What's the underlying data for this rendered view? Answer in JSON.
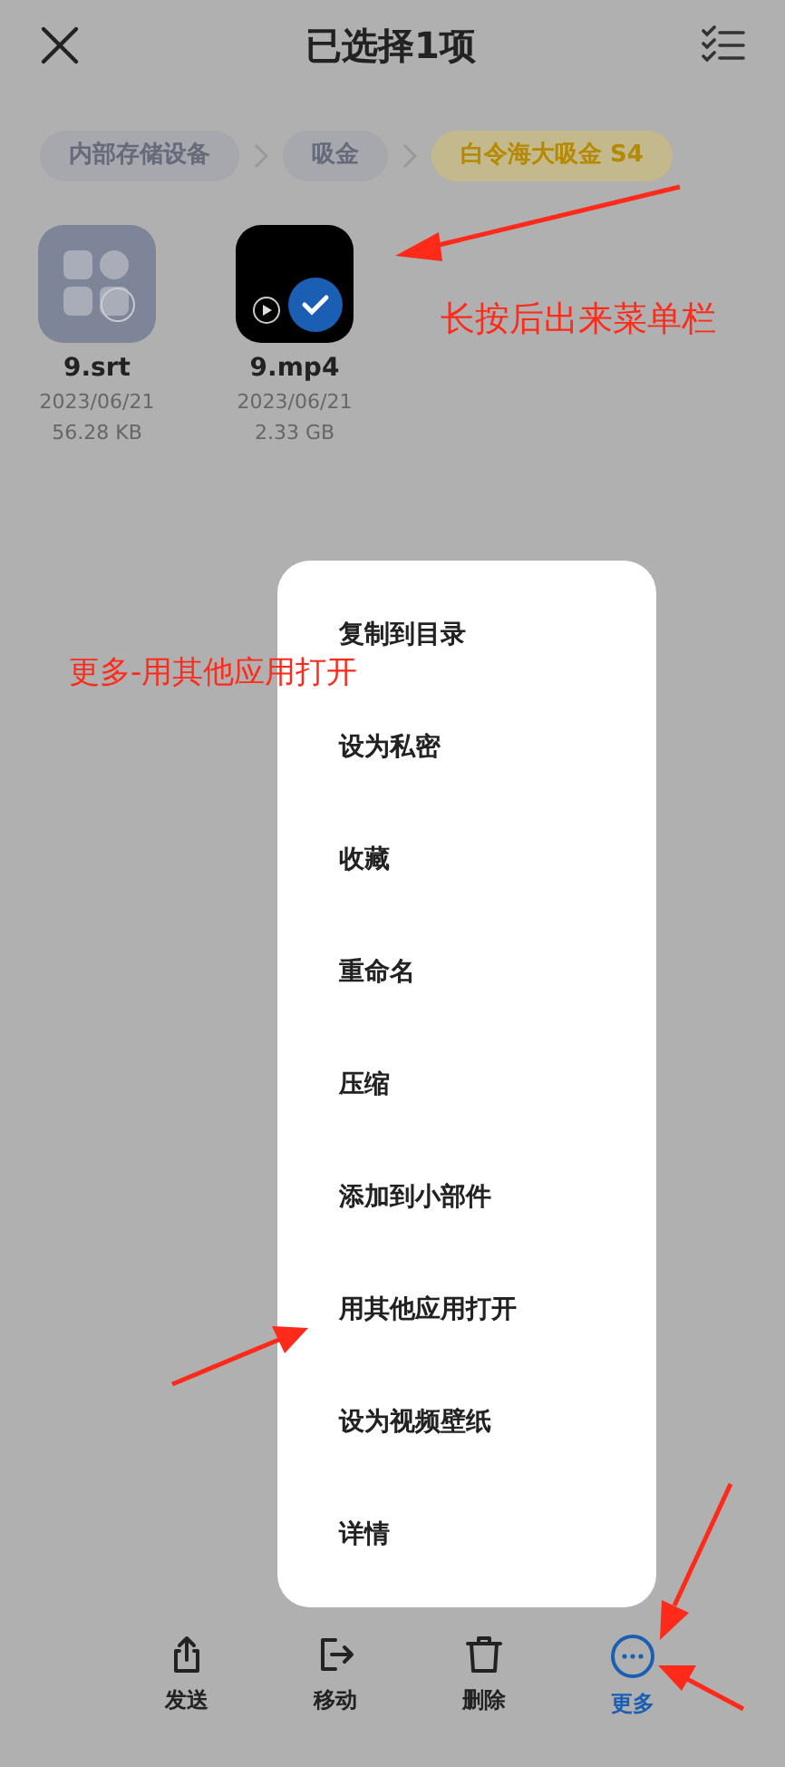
{
  "header": {
    "title": "已选择1项"
  },
  "breadcrumbs": [
    {
      "label": "内部存储设备",
      "selected": false
    },
    {
      "label": "吸金",
      "selected": false
    },
    {
      "label": "白令海大吸金 S4",
      "selected": true
    }
  ],
  "files": [
    {
      "kind": "subtitle",
      "name": "9.srt",
      "date": "2023/06/21",
      "size": "56.28 KB",
      "selected": false
    },
    {
      "kind": "video",
      "name": "9.mp4",
      "date": "2023/06/21",
      "size": "2.33 GB",
      "selected": true
    }
  ],
  "menu": {
    "items": [
      "复制到目录",
      "设为私密",
      "收藏",
      "重命名",
      "压缩",
      "添加到小部件",
      "用其他应用打开",
      "设为视频壁纸",
      "详情"
    ]
  },
  "bottom_bar": [
    {
      "kind": "send",
      "label": "发送",
      "selected": false
    },
    {
      "kind": "move",
      "label": "移动",
      "selected": false
    },
    {
      "kind": "delete",
      "label": "删除",
      "selected": false
    },
    {
      "kind": "more",
      "label": "更多",
      "selected": true
    }
  ],
  "annotations": [
    "长按后出来菜单栏",
    "更多-用其他应用打开"
  ]
}
